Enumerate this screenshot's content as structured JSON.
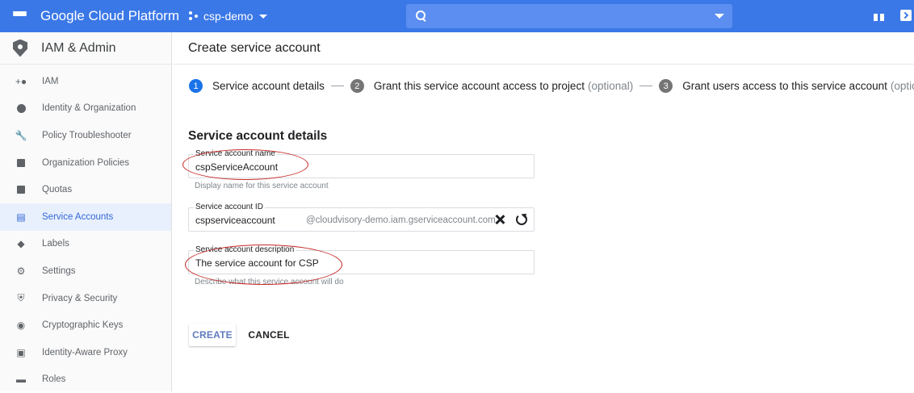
{
  "topbar": {
    "brand": "Google Cloud Platform",
    "project": "csp-demo",
    "search_placeholder": ""
  },
  "sidebar": {
    "title": "IAM & Admin",
    "items": [
      {
        "label": "IAM",
        "icon": "person-add-icon"
      },
      {
        "label": "Identity & Organization",
        "icon": "account-circle-icon"
      },
      {
        "label": "Policy Troubleshooter",
        "icon": "wrench-icon"
      },
      {
        "label": "Organization Policies",
        "icon": "list-icon"
      },
      {
        "label": "Quotas",
        "icon": "quota-icon"
      },
      {
        "label": "Service Accounts",
        "icon": "service-account-icon",
        "active": true
      },
      {
        "label": "Labels",
        "icon": "label-icon"
      },
      {
        "label": "Settings",
        "icon": "gear-icon"
      },
      {
        "label": "Privacy & Security",
        "icon": "shield-icon"
      },
      {
        "label": "Cryptographic Keys",
        "icon": "key-shield-icon"
      },
      {
        "label": "Identity-Aware Proxy",
        "icon": "proxy-icon"
      },
      {
        "label": "Roles",
        "icon": "roles-icon"
      }
    ]
  },
  "main": {
    "title": "Create service account",
    "steps": [
      {
        "num": "1",
        "label": "Service account details",
        "optional": ""
      },
      {
        "num": "2",
        "label": "Grant this service account access to project",
        "optional": "(optional)"
      },
      {
        "num": "3",
        "label": "Grant users access to this service account",
        "optional": "(optional)"
      }
    ],
    "section_title": "Service account details",
    "name_field": {
      "label": "Service account name",
      "value": "cspServiceAccount",
      "hint": "Display name for this service account"
    },
    "id_field": {
      "label": "Service account ID",
      "value": "cspserviceaccount",
      "suffix": "@cloudvisory-demo.iam.gserviceaccount.com"
    },
    "desc_field": {
      "label": "Service account description",
      "value": "The service account for CSP",
      "hint": "Describe what this service account will do"
    },
    "create_label": "CREATE",
    "cancel_label": "CANCEL"
  },
  "colors": {
    "topbar": "#3b78e7",
    "accent": "#1a73e8",
    "annotation": "#c62828"
  }
}
